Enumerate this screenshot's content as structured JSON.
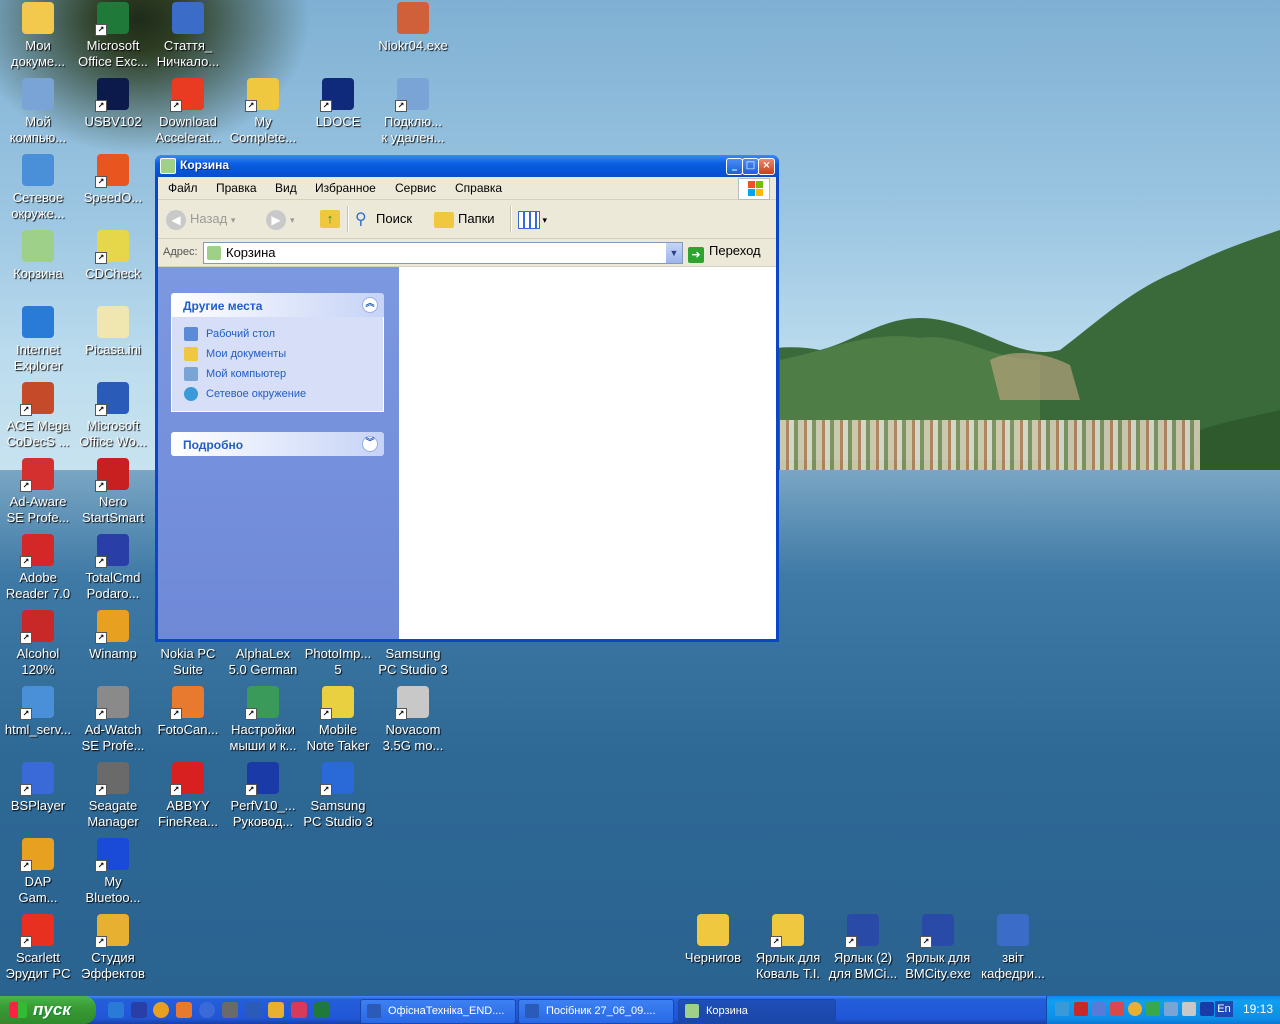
{
  "desktop_icons": [
    {
      "label": "Мои\nдокуме...",
      "icon": "my-documents-icon",
      "color": "#f2c94c"
    },
    {
      "label": "Microsoft\nOffice Exc...",
      "icon": "excel-icon",
      "color": "#1f7a3a"
    },
    {
      "label": "Стаття_\nНичкало...",
      "icon": "word-document-icon",
      "color": "#3b6cc7"
    },
    {
      "label": "Niokr04.exe",
      "icon": "exe-icon",
      "color": "#d0603a"
    },
    {
      "label": "Мой\nкомпью...",
      "icon": "my-computer-icon",
      "color": "#7aa3d6"
    },
    {
      "label": "USBV102",
      "icon": "usb-icon",
      "color": "#0b1a4a"
    },
    {
      "label": "Download\nAccelerat...",
      "icon": "download-accelerator-icon",
      "color": "#e83b22"
    },
    {
      "label": "My\nComplete...",
      "icon": "folder-icon",
      "color": "#f0c840"
    },
    {
      "label": "LDOCE",
      "icon": "dictionary-icon",
      "color": "#0f2a7a"
    },
    {
      "label": "Подклю...\nк удален...",
      "icon": "remote-desktop-icon",
      "color": "#7aa3d6"
    },
    {
      "label": "Сетевое\nокруже...",
      "icon": "network-icon",
      "color": "#4a90d9"
    },
    {
      "label": "SpeedO...",
      "icon": "speed-icon",
      "color": "#e8551e"
    },
    {
      "label": "Корзина",
      "icon": "recycle-bin-icon",
      "color": "#9fd08a"
    },
    {
      "label": "CDCheck",
      "icon": "cd-icon",
      "color": "#e6d64a"
    },
    {
      "label": "Internet\nExplorer",
      "icon": "ie-icon",
      "color": "#2a7ad8"
    },
    {
      "label": "Picasa.ini",
      "icon": "ini-file-icon",
      "color": "#f0e6b0"
    },
    {
      "label": "ACE Mega\nCoDecS ...",
      "icon": "codec-icon",
      "color": "#c44a2a"
    },
    {
      "label": "Microsoft\nOffice Wo...",
      "icon": "word-icon",
      "color": "#2b5bb8"
    },
    {
      "label": "Ad-Aware\nSE Profe...",
      "icon": "ad-aware-icon",
      "color": "#d43030"
    },
    {
      "label": "Nero\nStartSmart",
      "icon": "nero-icon",
      "color": "#c82020"
    },
    {
      "label": "Adobe\nReader 7.0",
      "icon": "adobe-reader-icon",
      "color": "#d42828"
    },
    {
      "label": "TotalCmd\nPodaro...",
      "icon": "totalcmd-icon",
      "color": "#2a3ea8"
    },
    {
      "label": "Alcohol\n120%",
      "icon": "alcohol-icon",
      "color": "#c82828"
    },
    {
      "label": "Winamp",
      "icon": "winamp-icon",
      "color": "#e8a020"
    },
    {
      "label": "Nokia PC\nSuite",
      "icon": "nokia-icon",
      "color": "#1a5ab8"
    },
    {
      "label": "AlphaLex\n5.0 German",
      "icon": "alphalex-icon",
      "color": "#3a8ad8"
    },
    {
      "label": "PhotoImp...\n5",
      "icon": "photoimpact-icon",
      "color": "#d8a030"
    },
    {
      "label": "Samsung\nPC Studio 3",
      "icon": "samsung-icon",
      "color": "#1a4aa8"
    },
    {
      "label": "html_serv...",
      "icon": "html-file-icon",
      "color": "#4a90d9"
    },
    {
      "label": "Ad-Watch\nSE Profe...",
      "icon": "ad-watch-icon",
      "color": "#8a8a8a"
    },
    {
      "label": "FotoCan...",
      "icon": "fotocanvas-icon",
      "color": "#e87a30"
    },
    {
      "label": "Настройки\nмыши и к...",
      "icon": "mouse-settings-icon",
      "color": "#3a9a5a"
    },
    {
      "label": "Mobile\nNote Taker",
      "icon": "note-taker-icon",
      "color": "#e8d040"
    },
    {
      "label": "Novacom\n3.5G mo...",
      "icon": "novacom-icon",
      "color": "#c8c8c8"
    },
    {
      "label": "BSPlayer",
      "icon": "bsplayer-icon",
      "color": "#3a6ad8"
    },
    {
      "label": "Seagate\nManager",
      "icon": "seagate-icon",
      "color": "#6a6a6a"
    },
    {
      "label": "ABBYY\nFineRea...",
      "icon": "abbyy-icon",
      "color": "#d82020"
    },
    {
      "label": "PerfV10_...\nРуковод...",
      "icon": "epson-manual-icon",
      "color": "#1a3aa8"
    },
    {
      "label": "Samsung\nPC Studio 3",
      "icon": "samsung-studio-icon",
      "color": "#2a6ad8"
    },
    {
      "label": "DAP\nGam...",
      "icon": "gamepad-icon",
      "color": "#e8a020"
    },
    {
      "label": "My\nBluetoo...",
      "icon": "bluetooth-icon",
      "color": "#1a4ad8"
    },
    {
      "label": "Scarlett\nЭрудит PC",
      "icon": "scarlett-icon",
      "color": "#e83020"
    },
    {
      "label": "Студия\nЭффектов",
      "icon": "effects-studio-icon",
      "color": "#e8b030"
    },
    {
      "label": "Чернигов",
      "icon": "folder-chernigov-icon",
      "color": "#f0c840"
    },
    {
      "label": "Ярлык для\nКоваль Т.І.",
      "icon": "folder-shortcut-icon",
      "color": "#f0c840"
    },
    {
      "label": "Ярлык (2)\nдля BMCi...",
      "icon": "kiev-icon",
      "color": "#2a4aa8"
    },
    {
      "label": "Ярлык для\nBMCity.exe",
      "icon": "kiev-bmcity-icon",
      "color": "#2a4aa8"
    },
    {
      "label": "звіт\nкафедри...",
      "icon": "word-report-icon",
      "color": "#3b6cc7"
    }
  ],
  "window": {
    "title": "Корзина",
    "menu": [
      "Файл",
      "Правка",
      "Вид",
      "Избранное",
      "Сервис",
      "Справка"
    ],
    "toolbar": {
      "back": "Назад",
      "search": "Поиск",
      "folders": "Папки"
    },
    "address_label": "Адрес:",
    "address_value": "Корзина",
    "go_label": "Переход",
    "panel_other": {
      "title": "Другие места",
      "links": [
        "Рабочий стол",
        "Мои документы",
        "Мой компьютер",
        "Сетевое окружение"
      ]
    },
    "panel_details": {
      "title": "Подробно"
    }
  },
  "taskbar": {
    "start_label": "пуск",
    "tasks": [
      "ОфіснаТехніка_END....",
      "Посібник 27_06_09....",
      "Корзина"
    ],
    "lang": "En",
    "clock": "19:13"
  }
}
